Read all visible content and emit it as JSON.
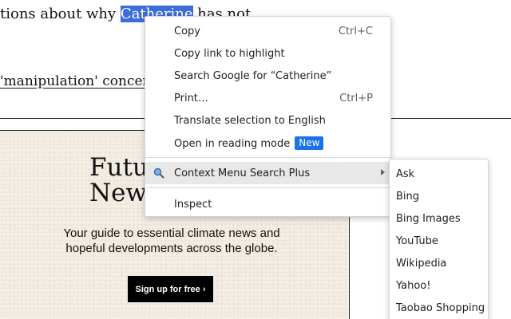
{
  "article": {
    "line1_before": "tions about why ",
    "line1_selected": "Catherine",
    "line1_after": " has not",
    "line2": "'manipulation' concer"
  },
  "promo": {
    "title": "Future News",
    "subtitle": "Your guide to essential climate news and hopeful developments across the globe.",
    "button_label": "Sign up for free ›"
  },
  "context_menu": {
    "copy": {
      "label": "Copy",
      "shortcut": "Ctrl+C"
    },
    "copy_link": {
      "label": "Copy link to highlight"
    },
    "search": {
      "label": "Search Google for  “Catherine”"
    },
    "print": {
      "label": "Print…",
      "shortcut": "Ctrl+P"
    },
    "translate": {
      "label": "Translate selection to English"
    },
    "reading_mode": {
      "label": "Open in reading mode",
      "badge": "New"
    },
    "extension": {
      "label": "Context Menu Search Plus",
      "icon": "magnifier-icon",
      "submenu_icon": "chevron-right-icon"
    },
    "inspect": {
      "label": "Inspect"
    }
  },
  "submenu": {
    "items": [
      "Ask",
      "Bing",
      "Bing Images",
      "YouTube",
      "Wikipedia",
      "Yahoo!",
      "Taobao Shopping"
    ]
  },
  "colors": {
    "selection": "#3d6cdb",
    "badge": "#1a73e8",
    "hover": "#e8e8e8"
  }
}
